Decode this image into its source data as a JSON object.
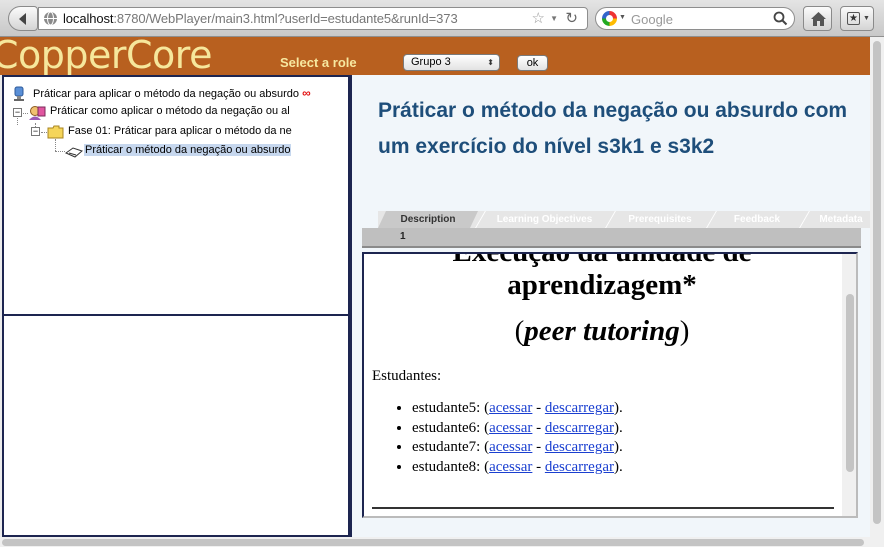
{
  "browser": {
    "url_host": "localhost",
    "url_rest": ":8780/WebPlayer/main3.html?userId=estudante5&runId=373",
    "search_placeholder": "Google"
  },
  "header": {
    "logo_text": "CopperCore",
    "role_label": "Select a role",
    "role_value": "Grupo 3",
    "ok_label": "ok",
    "logo_color": "#f6e79c",
    "bg_color": "#b8601f"
  },
  "tree": {
    "items": [
      {
        "label": "Práticar para aplicar o método da negação ou absurdo",
        "suffix": "∞",
        "icon": "run-icon"
      },
      {
        "label": "Práticar como aplicar o método da negação ou al",
        "icon": "role-icon"
      },
      {
        "label": "Fase 01: Práticar para aplicar o método da ne",
        "icon": "folder-icon"
      },
      {
        "label": "Práticar o método da negação ou absurdo",
        "icon": "activity-icon",
        "selected": true
      }
    ]
  },
  "content": {
    "title": "Práticar o método da negação ou absurdo com um exercício do nível s3k1 e s3k2",
    "title_color": "#1e4e7a",
    "tabs": [
      "Description",
      "Learning Objectives",
      "Prerequisites",
      "Feedback",
      "Metadata"
    ],
    "active_tab": "Description",
    "page_number": "1",
    "doc": {
      "heading_partial": "Execução da unidade de",
      "heading": "aprendizagem*",
      "subheading_open": "(",
      "subheading_em": "peer tutoring",
      "subheading_close": ")",
      "students_label": "Estudantes:",
      "students": [
        {
          "name": "estudante5: (",
          "access": "acessar",
          "sep": " - ",
          "download": "descarregar",
          "end": ")."
        },
        {
          "name": "estudante6: (",
          "access": "acessar",
          "sep": " - ",
          "download": "descarregar",
          "end": ")."
        },
        {
          "name": "estudante7: (",
          "access": "acessar",
          "sep": " - ",
          "download": "descarregar",
          "end": ")."
        },
        {
          "name": "estudante8: (",
          "access": "acessar",
          "sep": " - ",
          "download": "descarregar",
          "end": ")."
        }
      ]
    }
  }
}
